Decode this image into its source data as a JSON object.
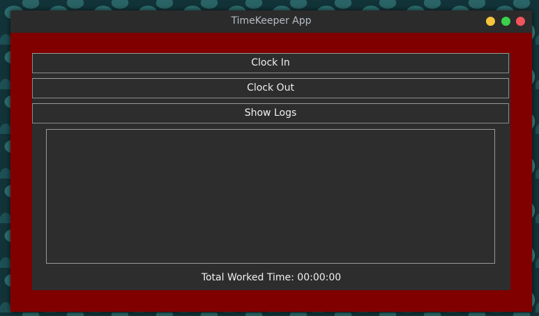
{
  "window": {
    "title": "TimeKeeper App",
    "controls": [
      "minimize",
      "maximize",
      "close"
    ]
  },
  "colors": {
    "frame": "#800000",
    "panel": "#2d2d2d",
    "titlebar": "#2b2b2b",
    "minimize": "#f7c53d",
    "maximize": "#3ad24b",
    "close": "#f2545b"
  },
  "actions": {
    "clock_in": "Clock In",
    "clock_out": "Clock Out",
    "show_logs": "Show Logs"
  },
  "logs": {
    "entries": []
  },
  "status": {
    "total_worked": "Total Worked Time: 00:00:00"
  }
}
